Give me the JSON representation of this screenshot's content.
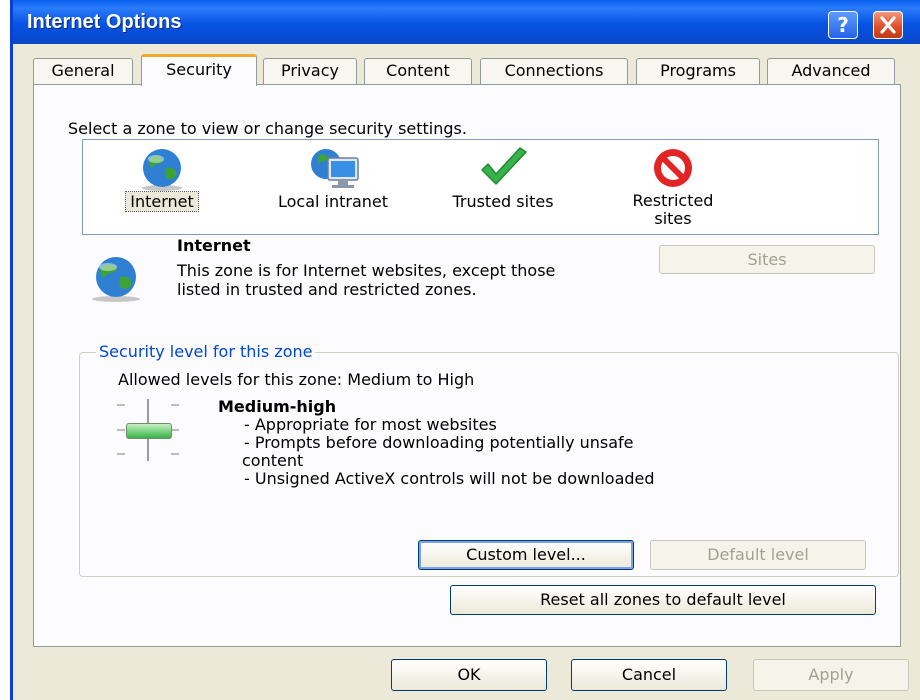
{
  "window": {
    "title": "Internet Options",
    "help_label": "?"
  },
  "tabs": [
    "General",
    "Security",
    "Privacy",
    "Content",
    "Connections",
    "Programs",
    "Advanced"
  ],
  "active_tab": "Security",
  "zones": {
    "prompt": "Select a zone to view or change security settings.",
    "items": [
      {
        "label": "Internet",
        "icon": "globe-icon"
      },
      {
        "label": "Local intranet",
        "icon": "intranet-icon"
      },
      {
        "label": "Trusted sites",
        "icon": "checkmark-icon"
      },
      {
        "label": "Restricted sites",
        "icon": "restricted-icon"
      }
    ],
    "selected": "Internet"
  },
  "zone_info": {
    "name": "Internet",
    "description": "This zone is for Internet websites, except those listed in trusted and restricted zones.",
    "sites_button": "Sites"
  },
  "security_level": {
    "group_label": "Security level for this zone",
    "allowed": "Allowed levels for this zone: Medium to High",
    "level_name": "Medium-high",
    "slider_level": 2,
    "bullets": [
      "- Appropriate for most websites",
      "- Prompts before downloading potentially unsafe",
      "content",
      "- Unsigned ActiveX controls will not be downloaded"
    ],
    "custom_button": "Custom level...",
    "default_button": "Default level"
  },
  "reset_button": "Reset all zones to default level",
  "footer": {
    "ok": "OK",
    "cancel": "Cancel",
    "apply": "Apply"
  },
  "colors": {
    "titlebar": "#0a5ff0",
    "tab_highlight": "#f0a830",
    "group_label": "#0046d5",
    "disabled_text": "#a1a192"
  }
}
